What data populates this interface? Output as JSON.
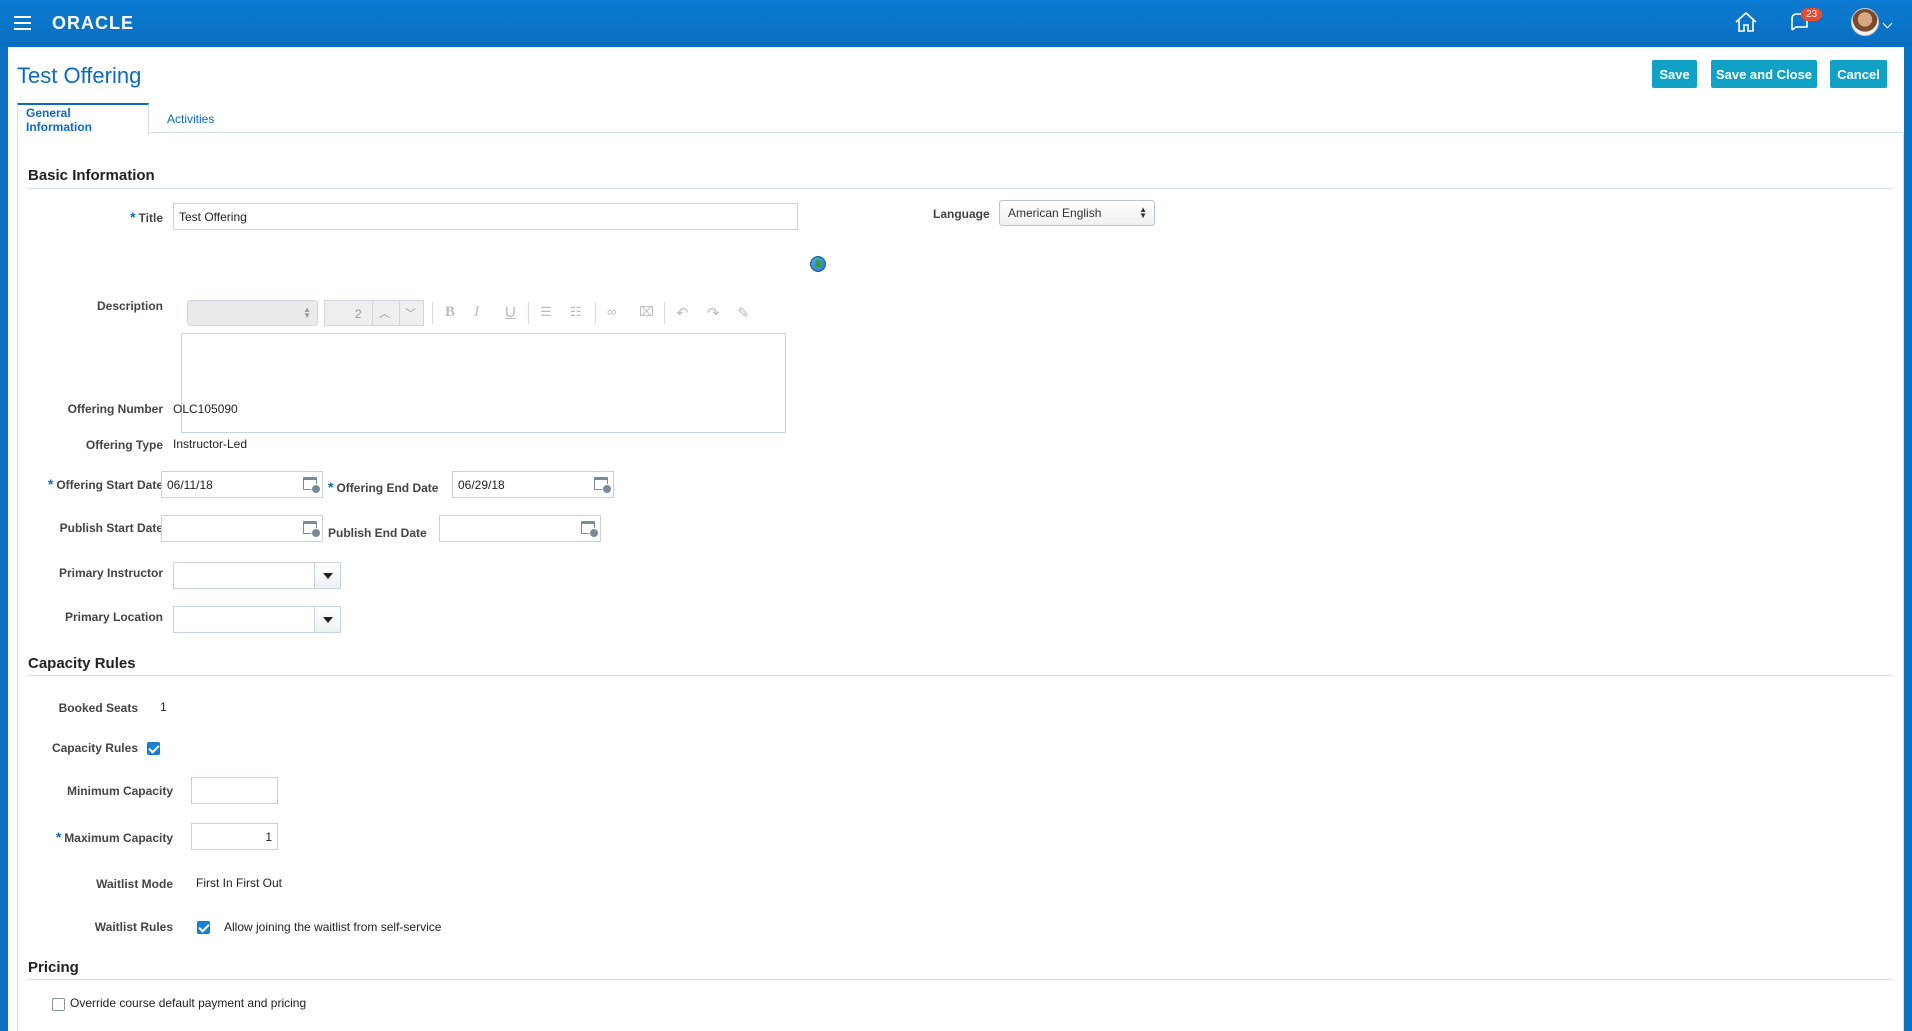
{
  "app": {
    "logo": "ORACLE",
    "notification_count": "23",
    "icons": {
      "menu": "hamburger-menu-icon",
      "home": "home-icon",
      "notifications": "bell-icon",
      "avatar": "user-avatar"
    }
  },
  "page": {
    "title": "Test Offering",
    "buttons": {
      "save": "Save",
      "save_and_close": "Save and Close",
      "cancel": "Cancel"
    },
    "tabs": [
      {
        "label": "General Information",
        "active": true
      },
      {
        "label": "Activities",
        "active": false
      }
    ]
  },
  "basic_information": {
    "heading": "Basic Information",
    "title_label": "Title",
    "title_value": "Test Offering",
    "language_label": "Language",
    "language_value": "American English",
    "description_label": "Description",
    "editor_font_size": "2",
    "offering_number_label": "Offering Number",
    "offering_number_value": "OLC105090",
    "offering_type_label": "Offering Type",
    "offering_type_value": "Instructor-Led",
    "start_date_label": "Offering Start Date",
    "start_date_value": "06/11/18",
    "end_date_label": "Offering End Date",
    "end_date_value": "06/29/18",
    "publish_start_label": "Publish Start Date",
    "publish_start_value": "",
    "publish_end_label": "Publish End Date",
    "publish_end_value": "",
    "primary_instructor_label": "Primary Instructor",
    "primary_location_label": "Primary Location"
  },
  "capacity_rules": {
    "heading": "Capacity Rules",
    "booked_seats_label": "Booked Seats",
    "booked_seats_value": "1",
    "capacity_rules_label": "Capacity Rules",
    "capacity_rules_checked": true,
    "min_capacity_label": "Minimum Capacity",
    "min_capacity_value": "",
    "max_capacity_label": "Maximum Capacity",
    "max_capacity_value": "1",
    "waitlist_mode_label": "Waitlist Mode",
    "waitlist_mode_value": "First In First Out",
    "waitlist_rules_label": "Waitlist Rules",
    "waitlist_rules_option": "Allow joining the waitlist from self-service",
    "waitlist_rules_checked": true
  },
  "pricing": {
    "heading": "Pricing",
    "override_label": "Override course default payment and pricing",
    "override_checked": false
  },
  "colors": {
    "brand_blue": "#0b7bd1",
    "button_teal": "#0fa2c6",
    "link_blue": "#0c6ac2",
    "badge_red": "#e84c2e"
  }
}
